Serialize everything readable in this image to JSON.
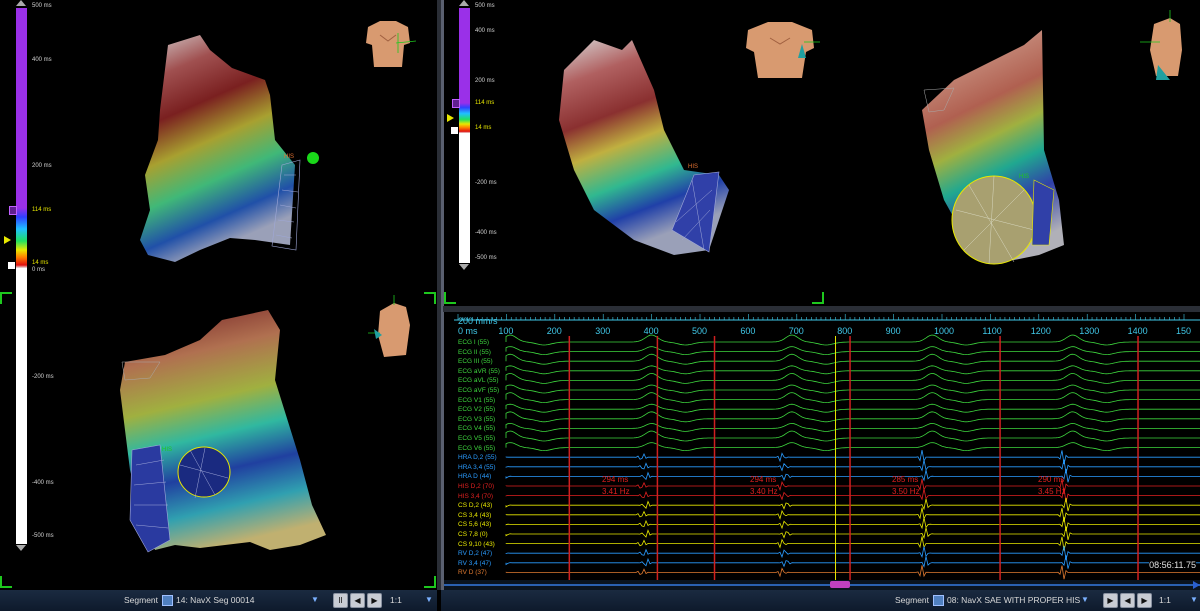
{
  "colors": {
    "accent_green": "#1ec81e",
    "scale_purple": "#9a30e8",
    "ecg_green": "#3ed63e",
    "ecg_blue": "#2a9cff",
    "ecg_red": "#e02020",
    "ecg_yellow": "#e8e800",
    "time_cyan": "#40c8e8"
  },
  "left_scale": {
    "top": "500 ms",
    "l400": "400 ms",
    "l200": "200 ms",
    "l114": "114 ms",
    "l14": "14 ms",
    "l0": "0 ms",
    "lm200": "-200 ms",
    "lm400": "-400 ms",
    "bottom": "-500 ms"
  },
  "right_scale": {
    "top": "500 ms",
    "l400": "400 ms",
    "l200": "200 ms",
    "l114": "114 ms",
    "l14": "14 ms",
    "lm200": "-200 ms",
    "lm400": "-400 ms",
    "bottom": "-500 ms"
  },
  "map_labels": {
    "his_a": "HIS",
    "his_b": "HIS",
    "his_c": "HIS",
    "his_d": "HIS"
  },
  "ecg": {
    "speed": "200 mm/s",
    "zero": "0 ms",
    "time_ticks": [
      "100",
      "200",
      "300",
      "400",
      "500",
      "600",
      "700",
      "800",
      "900",
      "1000",
      "1100",
      "1200",
      "1300",
      "1400",
      "150"
    ],
    "channels": [
      {
        "name": "ECG I (55)",
        "color": "#3ed63e"
      },
      {
        "name": "ECG II (55)",
        "color": "#3ed63e"
      },
      {
        "name": "ECG III (55)",
        "color": "#3ed63e"
      },
      {
        "name": "ECG aVR (55)",
        "color": "#3ed63e"
      },
      {
        "name": "ECG aVL (55)",
        "color": "#3ed63e"
      },
      {
        "name": "ECG aVF (55)",
        "color": "#3ed63e"
      },
      {
        "name": "ECG V1 (55)",
        "color": "#3ed63e"
      },
      {
        "name": "ECG V2 (55)",
        "color": "#3ed63e"
      },
      {
        "name": "ECG V3 (55)",
        "color": "#3ed63e"
      },
      {
        "name": "ECG V4 (55)",
        "color": "#3ed63e"
      },
      {
        "name": "ECG V5 (55)",
        "color": "#3ed63e"
      },
      {
        "name": "ECG V6 (55)",
        "color": "#3ed63e"
      },
      {
        "name": "HRA D,2 (55)",
        "color": "#2a9cff"
      },
      {
        "name": "HRA 3,4 (55)",
        "color": "#2a9cff"
      },
      {
        "name": "HRA D (44)",
        "color": "#2a9cff"
      },
      {
        "name": "HIS D,2 (70)",
        "color": "#e02020"
      },
      {
        "name": "HIS 3,4 (70)",
        "color": "#e02020"
      },
      {
        "name": "CS D,2 (43)",
        "color": "#e8e800"
      },
      {
        "name": "CS 3,4 (43)",
        "color": "#e8e800"
      },
      {
        "name": "CS 5,6 (43)",
        "color": "#e8e800"
      },
      {
        "name": "CS 7,8 (0)",
        "color": "#e8e800"
      },
      {
        "name": "CS 9,10 (43)",
        "color": "#e8e800"
      },
      {
        "name": "RV D,2 (47)",
        "color": "#2a9cff"
      },
      {
        "name": "RV 3,4 (47)",
        "color": "#2a9cff"
      },
      {
        "name": "RV D (37)",
        "color": "#e07a30"
      }
    ],
    "annotations": [
      {
        "ms": "294 ms",
        "hz": "3.41 Hz"
      },
      {
        "ms": "294 ms",
        "hz": "3.40 Hz"
      },
      {
        "ms": "285 ms",
        "hz": "3.50 Hz"
      },
      {
        "ms": "290 ms",
        "hz": "3.45 Hz"
      }
    ],
    "clock": "08:56:11.75"
  },
  "bottom_left": {
    "segment_label": "Segment",
    "segment_value": "14: NavX Seg 00014",
    "pause": "II",
    "prev": "◀",
    "next": "▶",
    "ratio": "1:1"
  },
  "bottom_right": {
    "segment_label": "Segment",
    "segment_value": "08: NavX SAE WITH PROPER HIS",
    "play": "▶",
    "prev": "◀",
    "next": "▶",
    "ratio": "1:1"
  }
}
